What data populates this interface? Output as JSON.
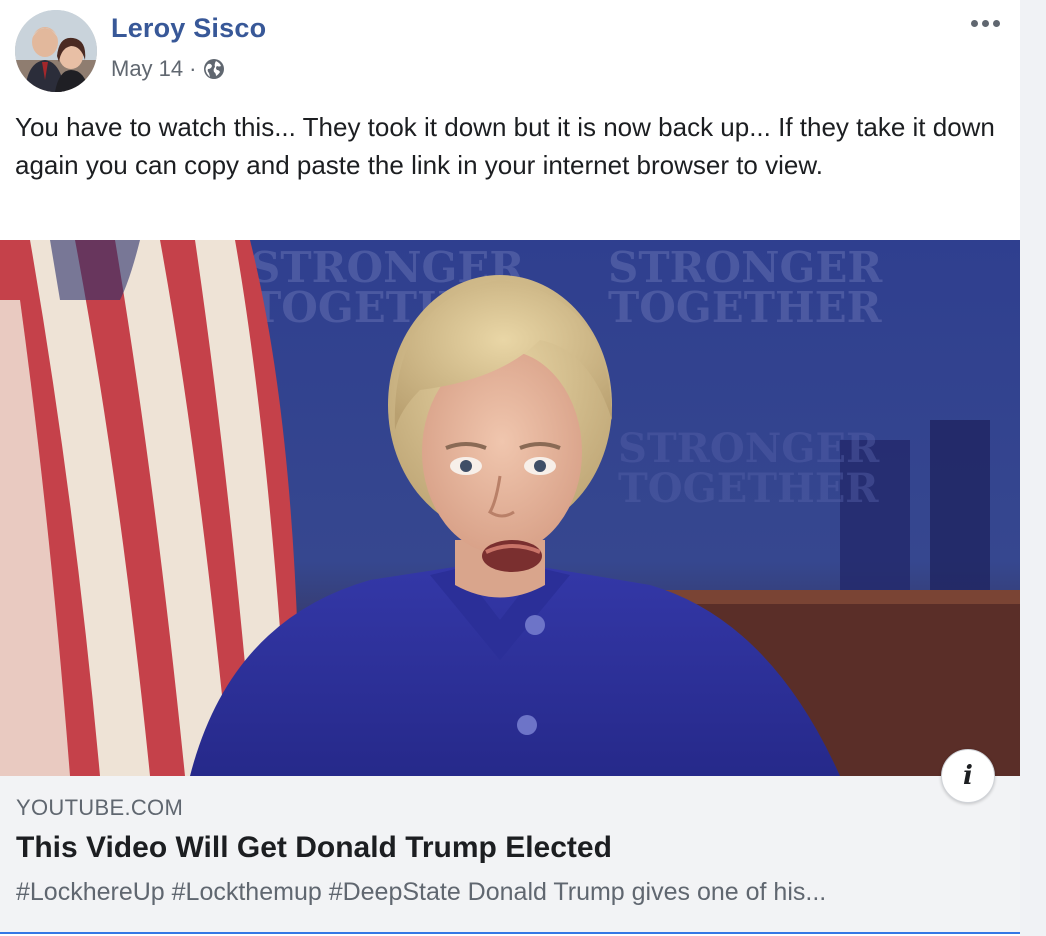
{
  "post": {
    "author": "Leroy Sisco",
    "date": "May 14",
    "separator": "·",
    "privacy_icon": "globe-icon",
    "menu_icon": "more-options-icon",
    "text": "You have to watch this... They took it down but it is now back up... If they take it down again you can copy and paste the link in your internet browser to view."
  },
  "video": {
    "backdrop_text": [
      "STRONGER",
      "TOGETHER"
    ]
  },
  "link_preview": {
    "domain": "YOUTUBE.COM",
    "title": "This Video Will Get Donald Trump Elected",
    "description": "#LockhereUp #Lockthemup #DeepState Donald Trump gives one of his...",
    "info_label": "i"
  },
  "colors": {
    "author_link": "#385898",
    "meta_text": "#606770",
    "body_text": "#1c1e21",
    "preview_bg": "#f2f3f5",
    "preview_border": "#3578e5"
  }
}
